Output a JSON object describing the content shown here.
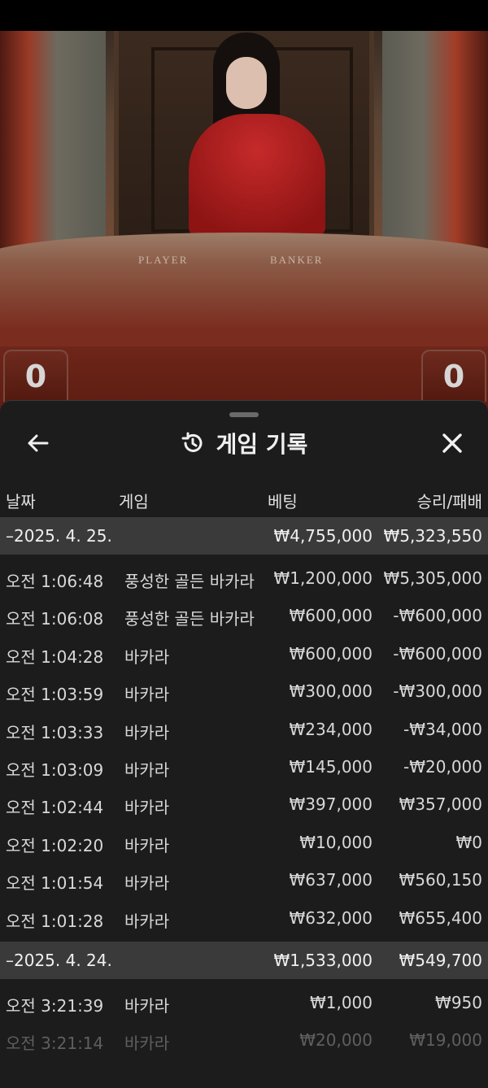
{
  "video": {
    "table_labels": {
      "player": "PLAYER",
      "banker": "BANKER"
    },
    "scores": {
      "player": "0",
      "banker": "0"
    }
  },
  "sheet": {
    "title": "게임 기록",
    "icons": {
      "back": "arrow-left-icon",
      "history": "history-icon",
      "close": "close-icon"
    },
    "columns": {
      "date": "날짜",
      "game": "게임",
      "bet": "베팅",
      "result": "승리/패배"
    },
    "groups": [
      {
        "date": "–2025. 4. 25.",
        "total_bet": "₩4,755,000",
        "total_result": "₩5,323,550",
        "rows": [
          {
            "time": "오전 1:06:48",
            "game": "풍성한 골든 바카라",
            "bet": "₩1,200,000",
            "result": "₩5,305,000"
          },
          {
            "time": "오전 1:06:08",
            "game": "풍성한 골든 바카라",
            "bet": "₩600,000",
            "result": "-₩600,000"
          },
          {
            "time": "오전 1:04:28",
            "game": "바카라",
            "bet": "₩600,000",
            "result": "-₩600,000"
          },
          {
            "time": "오전 1:03:59",
            "game": "바카라",
            "bet": "₩300,000",
            "result": "-₩300,000"
          },
          {
            "time": "오전 1:03:33",
            "game": "바카라",
            "bet": "₩234,000",
            "result": "-₩34,000"
          },
          {
            "time": "오전 1:03:09",
            "game": "바카라",
            "bet": "₩145,000",
            "result": "-₩20,000"
          },
          {
            "time": "오전 1:02:44",
            "game": "바카라",
            "bet": "₩397,000",
            "result": "₩357,000"
          },
          {
            "time": "오전 1:02:20",
            "game": "바카라",
            "bet": "₩10,000",
            "result": "₩0"
          },
          {
            "time": "오전 1:01:54",
            "game": "바카라",
            "bet": "₩637,000",
            "result": "₩560,150"
          },
          {
            "time": "오전 1:01:28",
            "game": "바카라",
            "bet": "₩632,000",
            "result": "₩655,400"
          }
        ]
      },
      {
        "date": "–2025. 4. 24.",
        "total_bet": "₩1,533,000",
        "total_result": "₩549,700",
        "rows": [
          {
            "time": "오전 3:21:39",
            "game": "바카라",
            "bet": "₩1,000",
            "result": "₩950"
          },
          {
            "time": "오전 3:21:14",
            "game": "바카라",
            "bet": "₩20,000",
            "result": "₩19,000"
          }
        ]
      }
    ]
  }
}
